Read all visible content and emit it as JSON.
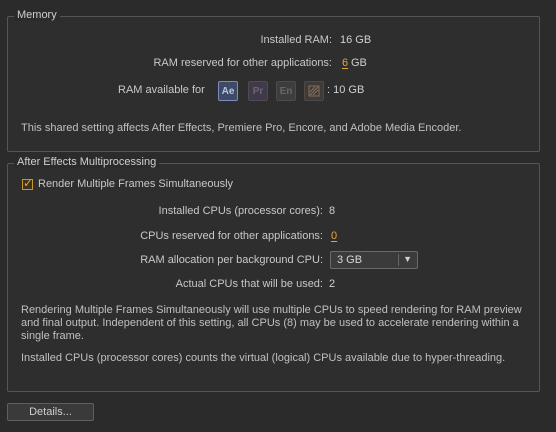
{
  "memory": {
    "title": "Memory",
    "installed_ram_label": "Installed RAM:",
    "installed_ram_value": "16 GB",
    "reserved_label": "RAM reserved for other applications:",
    "reserved_value": "6",
    "reserved_unit": "GB",
    "available_label": "RAM available for",
    "apps": [
      {
        "abbr": "Ae",
        "icon": "after-effects-icon",
        "active": true
      },
      {
        "abbr": "Pr",
        "icon": "premiere-pro-icon",
        "active": false
      },
      {
        "abbr": "En",
        "icon": "encore-icon",
        "active": false
      },
      {
        "abbr": "",
        "icon": "media-encoder-icon",
        "active": false
      }
    ],
    "available_value": ": 10 GB",
    "note": "This shared setting affects After Effects, Premiere Pro, Encore, and Adobe Media Encoder."
  },
  "multiprocessing": {
    "title": "After Effects Multiprocessing",
    "render_checkbox_label": "Render Multiple Frames Simultaneously",
    "render_checked": true,
    "installed_cpus_label": "Installed CPUs (processor cores):",
    "installed_cpus_value": "8",
    "cpus_reserved_label": "CPUs reserved for other applications:",
    "cpus_reserved_value": "0",
    "ram_alloc_label": "RAM allocation per background CPU:",
    "ram_alloc_value": "3 GB",
    "actual_cpus_label": "Actual CPUs that will be used:",
    "actual_cpus_value": "2",
    "note1": "Rendering Multiple Frames Simultaneously will use multiple CPUs to speed rendering for RAM preview and final output. Independent of this setting, all CPUs (8) may be used to accelerate rendering within a single frame.",
    "note2": "Installed CPUs (processor cores) counts the virtual (logical) CPUs available due to hyper-threading."
  },
  "buttons": {
    "details": "Details..."
  },
  "colors": {
    "background": "#2b2b2b",
    "accent": "#e8a535"
  }
}
